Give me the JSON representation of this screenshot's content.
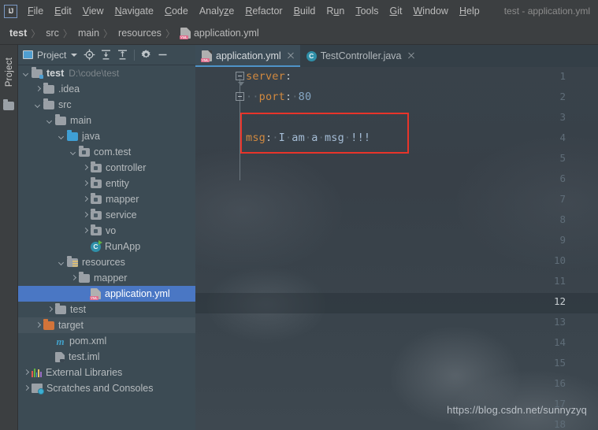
{
  "window": {
    "logo": "intellij-idea-logo",
    "title": "test - application.yml"
  },
  "menubar": {
    "items": [
      {
        "label": "File",
        "mnemonic": "F"
      },
      {
        "label": "Edit",
        "mnemonic": "E"
      },
      {
        "label": "View",
        "mnemonic": "V"
      },
      {
        "label": "Navigate",
        "mnemonic": "N"
      },
      {
        "label": "Code",
        "mnemonic": "C"
      },
      {
        "label": "Analyze",
        "mnemonic": "z"
      },
      {
        "label": "Refactor",
        "mnemonic": "R"
      },
      {
        "label": "Build",
        "mnemonic": "B"
      },
      {
        "label": "Run",
        "mnemonic": "u"
      },
      {
        "label": "Tools",
        "mnemonic": "T"
      },
      {
        "label": "Git",
        "mnemonic": "G"
      },
      {
        "label": "Window",
        "mnemonic": "W"
      },
      {
        "label": "Help",
        "mnemonic": "H"
      }
    ]
  },
  "breadcrumb": {
    "separator": "〉",
    "items": [
      {
        "label": "test",
        "icon": "none",
        "bold": true
      },
      {
        "label": "src",
        "icon": "none",
        "bold": false
      },
      {
        "label": "main",
        "icon": "none",
        "bold": false
      },
      {
        "label": "resources",
        "icon": "none",
        "bold": false
      },
      {
        "label": "application.yml",
        "icon": "yml-file-icon",
        "bold": false
      }
    ]
  },
  "left_strip": {
    "tool_window_label": "Project",
    "icon": "project-folder-icon"
  },
  "project_panel": {
    "toolbar": {
      "title": "Project",
      "dropdown_icon": "chevron-down-icon",
      "buttons": [
        {
          "name": "locate-in-tree-icon",
          "tooltip": "Select Opened File"
        },
        {
          "name": "expand-all-icon",
          "tooltip": "Expand All"
        },
        {
          "name": "collapse-all-icon",
          "tooltip": "Collapse All"
        },
        {
          "name": "settings-gear-icon",
          "tooltip": "Settings"
        },
        {
          "name": "hide-window-icon",
          "tooltip": "Hide"
        }
      ]
    },
    "tree": [
      {
        "label": "test",
        "detail": "D:\\code\\test",
        "indent": 0,
        "arrow": "down",
        "icon": "module-folder-icon",
        "state": "normal",
        "bold": true
      },
      {
        "label": ".idea",
        "detail": "",
        "indent": 1,
        "arrow": "right",
        "icon": "folder-icon",
        "state": "normal",
        "bold": false
      },
      {
        "label": "src",
        "detail": "",
        "indent": 1,
        "arrow": "down",
        "icon": "folder-icon",
        "state": "normal",
        "bold": false
      },
      {
        "label": "main",
        "detail": "",
        "indent": 2,
        "arrow": "down",
        "icon": "folder-icon",
        "state": "normal",
        "bold": false
      },
      {
        "label": "java",
        "detail": "",
        "indent": 3,
        "arrow": "down",
        "icon": "source-root-folder-icon",
        "state": "normal",
        "bold": false
      },
      {
        "label": "com.test",
        "detail": "",
        "indent": 4,
        "arrow": "down",
        "icon": "package-icon",
        "state": "normal",
        "bold": false
      },
      {
        "label": "controller",
        "detail": "",
        "indent": 5,
        "arrow": "right",
        "icon": "package-icon",
        "state": "normal",
        "bold": false
      },
      {
        "label": "entity",
        "detail": "",
        "indent": 5,
        "arrow": "right",
        "icon": "package-icon",
        "state": "normal",
        "bold": false
      },
      {
        "label": "mapper",
        "detail": "",
        "indent": 5,
        "arrow": "right",
        "icon": "package-icon",
        "state": "normal",
        "bold": false
      },
      {
        "label": "service",
        "detail": "",
        "indent": 5,
        "arrow": "right",
        "icon": "package-icon",
        "state": "normal",
        "bold": false
      },
      {
        "label": "vo",
        "detail": "",
        "indent": 5,
        "arrow": "right",
        "icon": "package-icon",
        "state": "normal",
        "bold": false
      },
      {
        "label": "RunApp",
        "detail": "",
        "indent": 5,
        "arrow": "none",
        "icon": "runnable-class-icon",
        "state": "normal",
        "bold": false
      },
      {
        "label": "resources",
        "detail": "",
        "indent": 3,
        "arrow": "down",
        "icon": "resource-root-folder-icon",
        "state": "normal",
        "bold": false
      },
      {
        "label": "mapper",
        "detail": "",
        "indent": 4,
        "arrow": "right",
        "icon": "folder-icon",
        "state": "normal",
        "bold": false
      },
      {
        "label": "application.yml",
        "detail": "",
        "indent": 5,
        "arrow": "none",
        "icon": "yml-file-icon",
        "state": "selected",
        "bold": false
      },
      {
        "label": "test",
        "detail": "",
        "indent": 2,
        "arrow": "right",
        "icon": "folder-icon",
        "state": "normal",
        "bold": false
      },
      {
        "label": "target",
        "detail": "",
        "indent": 1,
        "arrow": "right",
        "icon": "excluded-folder-icon",
        "state": "hovered",
        "bold": false
      },
      {
        "label": "pom.xml",
        "detail": "",
        "indent": 2,
        "arrow": "none",
        "icon": "maven-file-icon",
        "state": "normal",
        "bold": false
      },
      {
        "label": "test.iml",
        "detail": "",
        "indent": 2,
        "arrow": "none",
        "icon": "iml-file-icon",
        "state": "normal",
        "bold": false
      },
      {
        "label": "External Libraries",
        "detail": "",
        "indent": 0,
        "arrow": "right",
        "icon": "external-libraries-icon",
        "state": "normal",
        "bold": false
      },
      {
        "label": "Scratches and Consoles",
        "detail": "",
        "indent": 0,
        "arrow": "right",
        "icon": "scratches-icon",
        "state": "normal",
        "bold": false
      }
    ]
  },
  "editor": {
    "tabs": [
      {
        "label": "application.yml",
        "icon": "yml-file-icon",
        "active": true,
        "close": "close-icon"
      },
      {
        "label": "TestController.java",
        "icon": "java-class-icon",
        "active": false,
        "close": "close-icon"
      }
    ],
    "line_numbers": [
      1,
      2,
      3,
      4,
      5,
      6,
      7,
      8,
      9,
      10,
      11,
      12,
      13,
      14,
      15,
      16,
      17,
      18
    ],
    "current_line": 12,
    "code_lines": [
      {
        "line": 1,
        "indent": 0,
        "key": "server",
        "colon": ":",
        "value": "",
        "value_type": "none"
      },
      {
        "line": 2,
        "indent": 2,
        "key": "port",
        "colon": ":",
        "value": "80",
        "value_type": "number"
      },
      {
        "line": 4,
        "indent": 0,
        "key": "msg",
        "colon": ":",
        "value": "I am a msg !!!",
        "value_type": "string"
      }
    ],
    "annotation": {
      "shape": "red-rectangle",
      "color": "#e8342a",
      "target_line": 4
    },
    "watermark": "https://blog.csdn.net/sunnyzyq"
  },
  "colors": {
    "accent_blue": "#4a77c4",
    "tab_underline": "#4f93c8",
    "yaml_key": "#d1893f",
    "yaml_number": "#86a7c4",
    "yaml_string": "#a5bdd6",
    "annotation_red": "#e8342a",
    "panel_bg": "#3c4b54",
    "chrome_bg": "#3c3f41"
  }
}
